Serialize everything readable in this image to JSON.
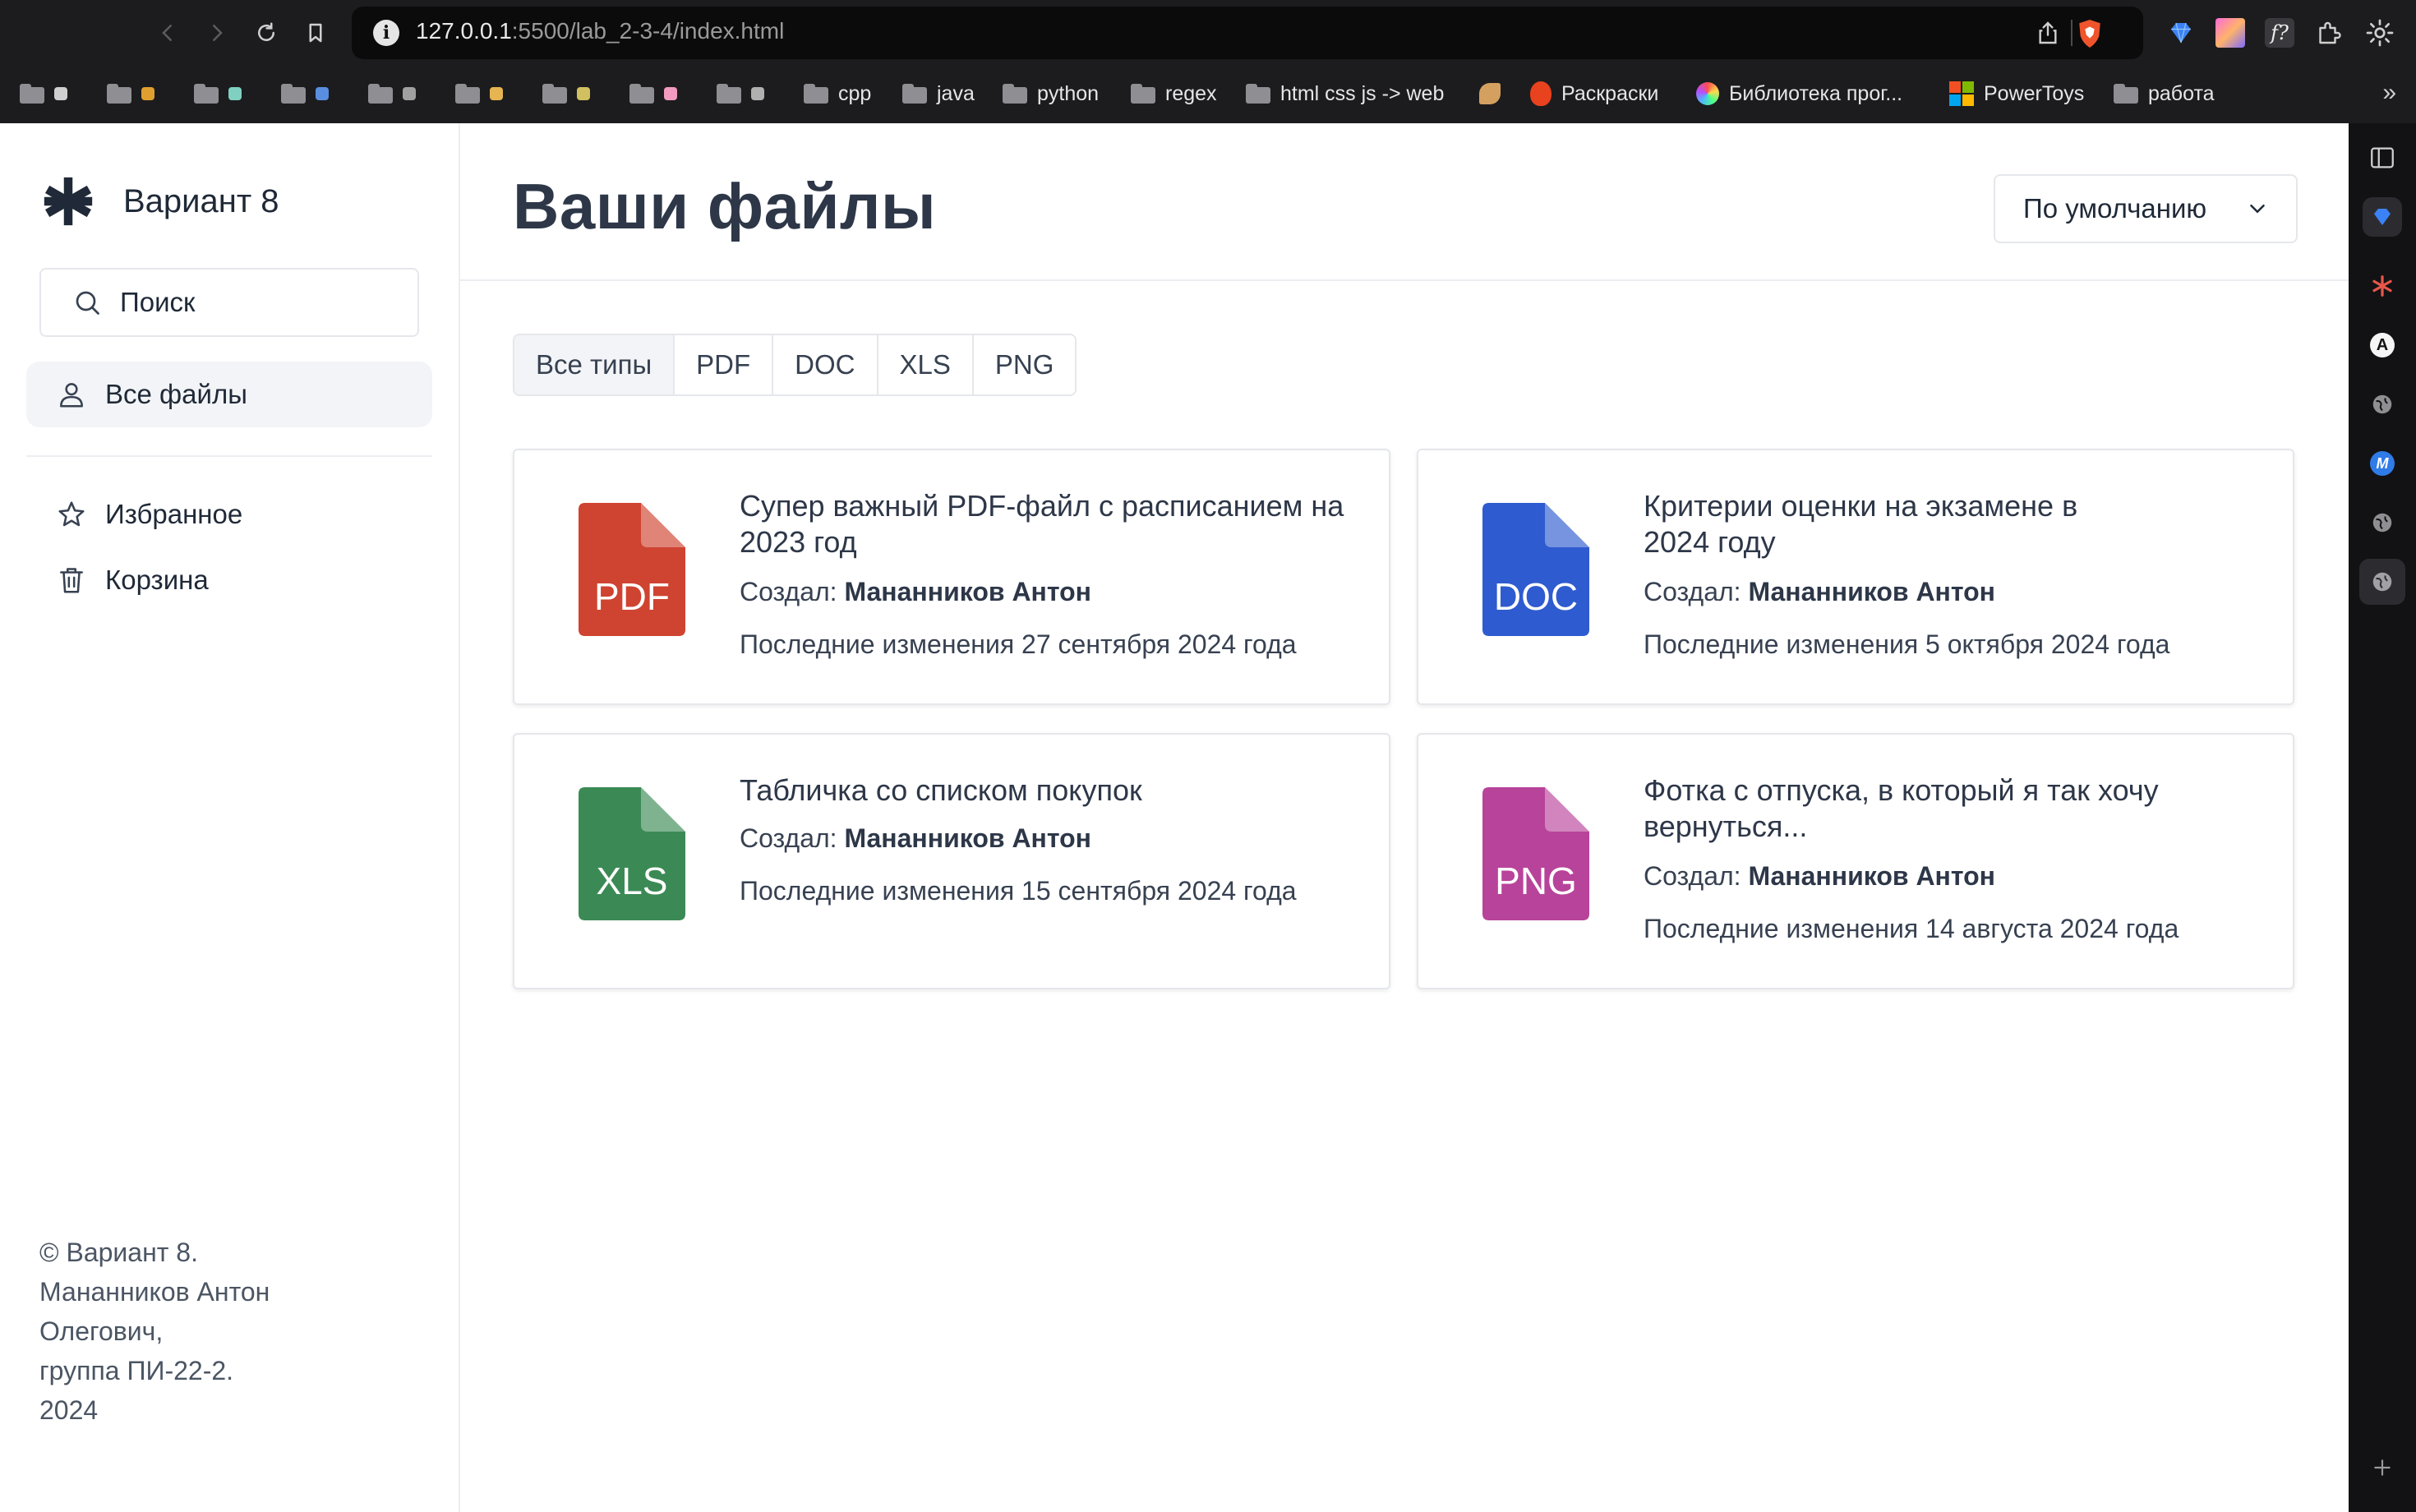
{
  "browser": {
    "url_host": "127.0.0.1",
    "url_rest": ":5500/lab_2-3-4/index.html",
    "bookmarks": [
      {
        "label": "",
        "type": "folder"
      },
      {
        "label": "",
        "type": "folder"
      },
      {
        "label": "",
        "type": "folder"
      },
      {
        "label": "",
        "type": "folder"
      },
      {
        "label": "",
        "type": "folder"
      },
      {
        "label": "",
        "type": "folder"
      },
      {
        "label": "",
        "type": "folder"
      },
      {
        "label": "",
        "type": "folder"
      },
      {
        "label": "",
        "type": "folder"
      },
      {
        "label": "cpp",
        "type": "folder"
      },
      {
        "label": "java",
        "type": "folder"
      },
      {
        "label": "python",
        "type": "folder"
      },
      {
        "label": "regex",
        "type": "folder"
      },
      {
        "label": "html css js -> web",
        "type": "folder"
      },
      {
        "label": "",
        "type": "site"
      },
      {
        "label": "Раскраски",
        "type": "site"
      },
      {
        "label": "Библиотека прог...",
        "type": "site"
      },
      {
        "label": "PowerToys",
        "type": "site"
      },
      {
        "label": "работа",
        "type": "folder"
      }
    ],
    "more_label": "»"
  },
  "sidebar": {
    "brand": "Вариант 8",
    "search_placeholder": "Поиск",
    "items": [
      {
        "label": "Все файлы",
        "icon": "user-icon",
        "active": true
      },
      {
        "label": "Избранное",
        "icon": "star-icon",
        "active": false
      },
      {
        "label": "Корзина",
        "icon": "trash-icon",
        "active": false
      }
    ],
    "footer": [
      "© Вариант 8.",
      "Мананников Антон",
      "Олегович,",
      "группа ПИ-22-2.",
      "2024"
    ]
  },
  "main": {
    "title": "Ваши файлы",
    "sort_label": "По умолчанию",
    "filters": [
      {
        "label": "Все типы",
        "active": true
      },
      {
        "label": "PDF",
        "active": false
      },
      {
        "label": "DOC",
        "active": false
      },
      {
        "label": "XLS",
        "active": false
      },
      {
        "label": "PNG",
        "active": false
      }
    ],
    "files": [
      {
        "type": "PDF",
        "color": "#cf4331",
        "title": "Супер важный PDF-файл с расписанием на 2023 год",
        "author_label": "Создал:",
        "author": "Мананников Антон",
        "modified": "Последние изменения 27 сентября 2024 года"
      },
      {
        "type": "DOC",
        "color": "#2f5bd0",
        "title": "Критерии оценки на экзамене в 2024 году",
        "author_label": "Создал:",
        "author": "Мананников Антон",
        "modified": "Последние изменения 5 октября 2024 года"
      },
      {
        "type": "XLS",
        "color": "#3b8a55",
        "title": "Табличка со списком покупок",
        "author_label": "Создал:",
        "author": "Мананников Антон",
        "modified": "Последние изменения 15 сентября 2024 года"
      },
      {
        "type": "PNG",
        "color": "#b8439a",
        "title": "Фотка с отпуска, в который я так хочу вернуться...",
        "author_label": "Создал:",
        "author": "Мананников Антон",
        "modified": "Последние изменения 14 августа 2024 года"
      }
    ]
  }
}
